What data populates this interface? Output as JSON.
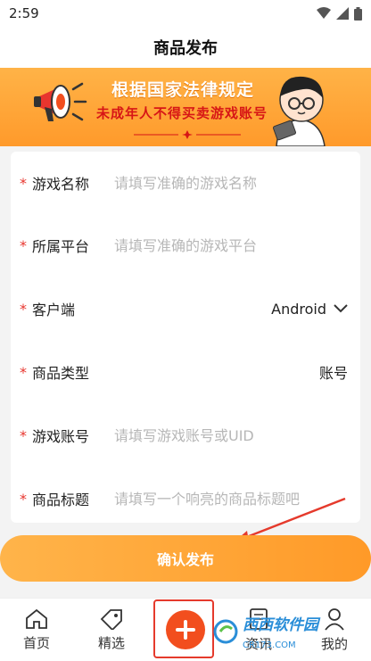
{
  "status_bar": {
    "time": "2:59"
  },
  "header": {
    "title": "商品发布"
  },
  "banner": {
    "line1": "根据国家法律规定",
    "line2": "未成年人不得买卖游戏账号"
  },
  "form": {
    "rows": [
      {
        "label": "游戏名称",
        "placeholder": "请填写准确的游戏名称"
      },
      {
        "label": "所属平台",
        "placeholder": "请填写准确的游戏平台"
      },
      {
        "label": "客户端",
        "value": "Android"
      },
      {
        "label": "商品类型",
        "value": "账号"
      },
      {
        "label": "游戏账号",
        "placeholder": "请填写游戏账号或UID"
      },
      {
        "label": "商品标题",
        "placeholder": "请填写一个响亮的商品标题吧"
      }
    ],
    "required_mark": "*"
  },
  "confirm_button": {
    "label": "确认发布"
  },
  "tab_bar": {
    "items": [
      {
        "label": "首页",
        "icon": "home-icon"
      },
      {
        "label": "精选",
        "icon": "tag-icon"
      },
      {
        "label": "",
        "icon": "plus-icon"
      },
      {
        "label": "资讯",
        "icon": "document-icon"
      },
      {
        "label": "我的",
        "icon": "user-icon"
      }
    ]
  },
  "watermark": {
    "text": "西西软件园",
    "sub": "CR173.COM"
  },
  "colors": {
    "accent": "#ff9a28",
    "publish": "#f24e1e",
    "required": "#e8352e",
    "highlight": "#e53a2c"
  }
}
